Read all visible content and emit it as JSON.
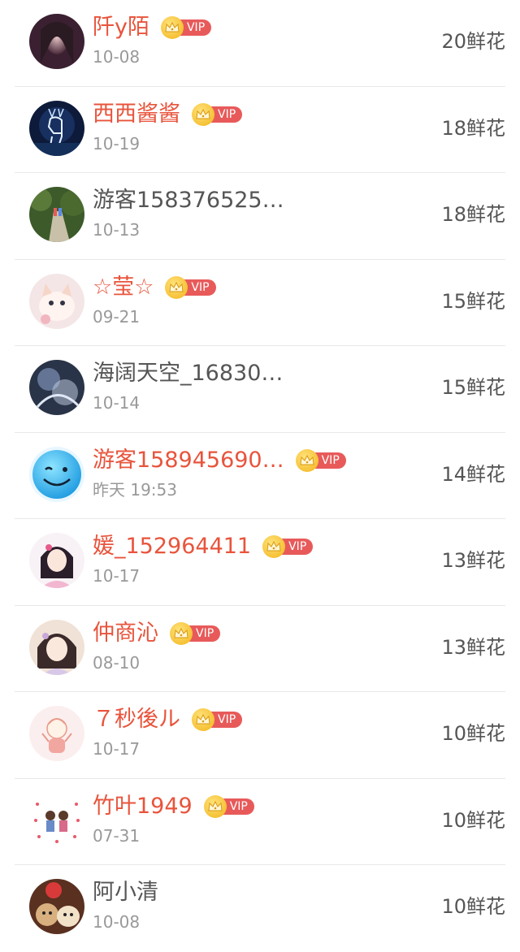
{
  "gift_list": {
    "vip_badge_text": "VIP",
    "accent_color": "#e8543c",
    "rows": [
      {
        "name": "阡y陌",
        "vip": true,
        "date": "10-08",
        "flowers": "20鲜花",
        "avatar": "girl-portrait"
      },
      {
        "name": "西西酱酱",
        "vip": true,
        "date": "10-19",
        "flowers": "18鲜花",
        "avatar": "deer-night"
      },
      {
        "name": "游客158376525…",
        "vip": false,
        "date": "10-13",
        "flowers": "18鲜花",
        "avatar": "forest-path"
      },
      {
        "name": "☆莹☆",
        "vip": true,
        "date": "09-21",
        "flowers": "15鲜花",
        "avatar": "kitten"
      },
      {
        "name": "海阔天空_16830…",
        "vip": false,
        "date": "10-14",
        "flowers": "15鲜花",
        "avatar": "dark-abstract"
      },
      {
        "name": "游客158945690…",
        "vip": true,
        "date": "昨天 19:53",
        "flowers": "14鲜花",
        "avatar": "blue-smiley"
      },
      {
        "name": "媛_152964411",
        "vip": true,
        "date": "10-17",
        "flowers": "13鲜花",
        "avatar": "anime-girl"
      },
      {
        "name": "仲商沁",
        "vip": true,
        "date": "08-10",
        "flowers": "13鲜花",
        "avatar": "anime-girl-2"
      },
      {
        "name": "７秒後ル",
        "vip": true,
        "date": "10-17",
        "flowers": "10鲜花",
        "avatar": "cartoon-kid"
      },
      {
        "name": "竹叶1949",
        "vip": true,
        "date": "07-31",
        "flowers": "10鲜花",
        "avatar": "couple-cartoon"
      },
      {
        "name": "阿小清",
        "vip": false,
        "date": "10-08",
        "flowers": "10鲜花",
        "avatar": "puppies"
      }
    ]
  }
}
